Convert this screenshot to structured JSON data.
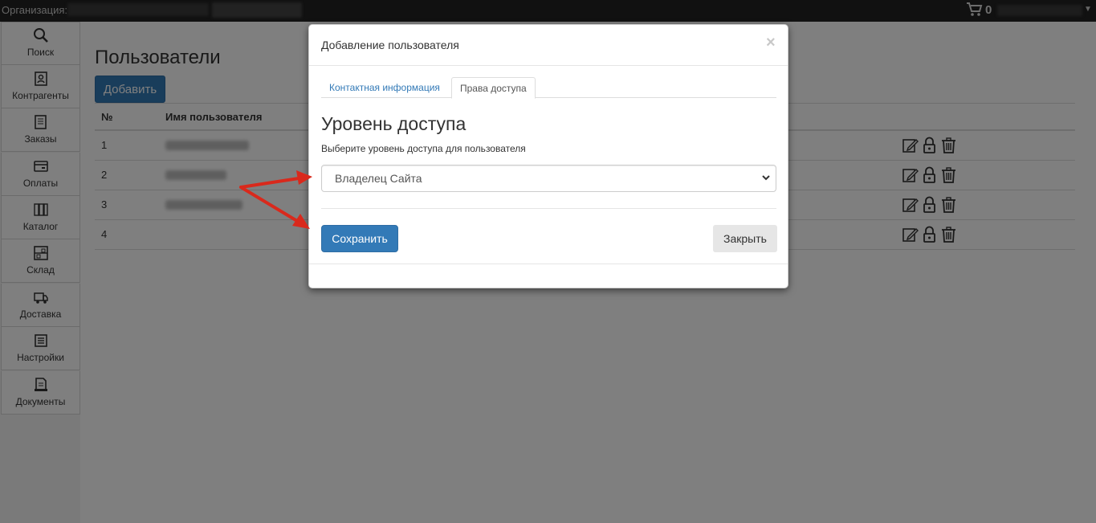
{
  "topbar": {
    "org_label": "Организация:",
    "cart_count": "0"
  },
  "sidebar": {
    "items": [
      {
        "label": "Поиск",
        "icon": "search-icon"
      },
      {
        "label": "Контрагенты",
        "icon": "contacts-icon"
      },
      {
        "label": "Заказы",
        "icon": "orders-icon"
      },
      {
        "label": "Оплаты",
        "icon": "payments-icon"
      },
      {
        "label": "Каталог",
        "icon": "catalog-icon"
      },
      {
        "label": "Склад",
        "icon": "warehouse-icon"
      },
      {
        "label": "Доставка",
        "icon": "delivery-icon"
      },
      {
        "label": "Настройки",
        "icon": "settings-icon"
      },
      {
        "label": "Документы",
        "icon": "documents-icon"
      }
    ]
  },
  "main": {
    "title": "Пользователи",
    "add_button": "Добавить",
    "table": {
      "columns": [
        "№",
        "Имя пользователя"
      ],
      "rows": [
        {
          "num": "1"
        },
        {
          "num": "2"
        },
        {
          "num": "3"
        },
        {
          "num": "4"
        }
      ],
      "row_actions": [
        "edit-icon",
        "lock-icon",
        "trash-icon"
      ]
    }
  },
  "modal": {
    "title": "Добавление пользователя",
    "close_symbol": "×",
    "tabs": [
      {
        "label": "Контактная информация",
        "active": false
      },
      {
        "label": "Права доступа",
        "active": true
      }
    ],
    "section_title": "Уровень доступа",
    "help_text": "Выберите уровень доступа для пользователя",
    "access_level": "Владелец Сайта",
    "save_button": "Сохранить",
    "close_button": "Закрыть"
  },
  "colors": {
    "primary": "#337ab7",
    "topbar": "#222222",
    "annotation_arrow": "#d9291c"
  }
}
